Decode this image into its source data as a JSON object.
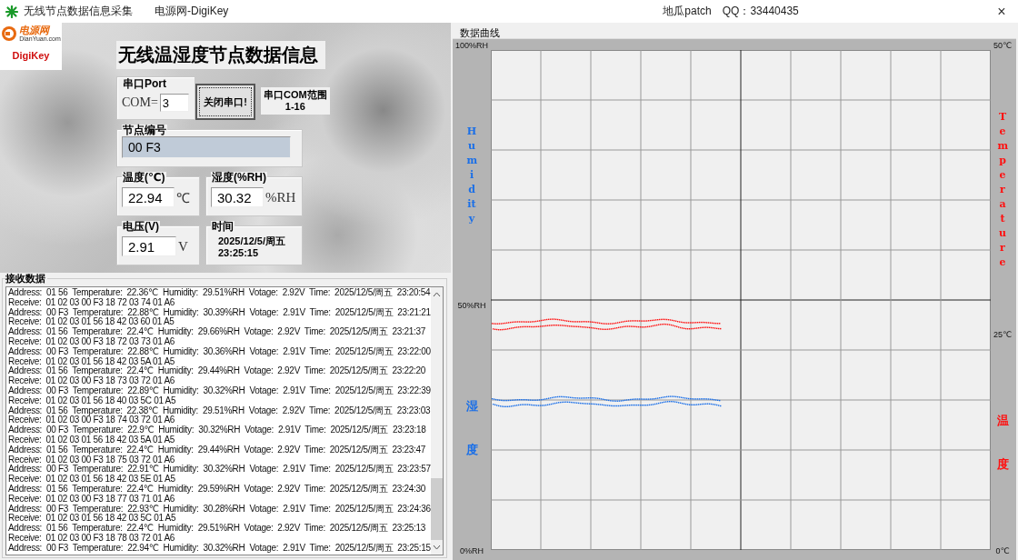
{
  "title_bar": {
    "app_title": "无线节点数据信息采集",
    "menu_item": "电源网-DigiKey",
    "author": "地瓜patch",
    "contact": "QQ：33440435",
    "close": "×"
  },
  "logos": {
    "brand_top": "电源网",
    "brand_top_sub": "DianYuan.com",
    "brand_bottom": "DigiKey"
  },
  "heading": "无线温湿度节点数据信息",
  "port": {
    "label": "串口Port",
    "prefix": "COM=",
    "value": "3",
    "button": "关闭串口!",
    "range_lines": [
      "串口COM范围",
      "1-16"
    ]
  },
  "node": {
    "label": "节点编号",
    "value": "00 F3"
  },
  "readings": [
    {
      "label": "温度(℃)",
      "value": "22.94",
      "unit": "℃"
    },
    {
      "label": "湿度(%RH)",
      "value": "30.32",
      "unit": "%RH"
    },
    {
      "label": "电压(V)",
      "value": "2.91",
      "unit": "V"
    }
  ],
  "time": {
    "label": "时间",
    "lines": [
      "2025/12/5/周五",
      "23:25:15"
    ]
  },
  "log": {
    "title": "接收数据",
    "lines": [
      "Address:  01 56  Temperature:  22.36℃  Humidity:  29.51%RH  Votage:  2.92V  Time:  2025/12/5/周五  23:20:54",
      "Receive:  01 02 03 00 F3 18 72 03 74 01 A6",
      "Address:  00 F3  Temperature:  22.88℃  Humidity:  30.39%RH  Votage:  2.91V  Time:  2025/12/5/周五  23:21:21",
      "Receive:  01 02 03 01 56 18 42 03 60 01 A5",
      "Address:  01 56  Temperature:  22.4℃  Humidity:  29.66%RH  Votage:  2.92V  Time:  2025/12/5/周五  23:21:37",
      "Receive:  01 02 03 00 F3 18 72 03 73 01 A6",
      "Address:  00 F3  Temperature:  22.88℃  Humidity:  30.36%RH  Votage:  2.91V  Time:  2025/12/5/周五  23:22:00",
      "Receive:  01 02 03 01 56 18 42 03 5A 01 A5",
      "Address:  01 56  Temperature:  22.4℃  Humidity:  29.44%RH  Votage:  2.92V  Time:  2025/12/5/周五  23:22:20",
      "Receive:  01 02 03 00 F3 18 73 03 72 01 A6",
      "Address:  00 F3  Temperature:  22.89℃  Humidity:  30.32%RH  Votage:  2.91V  Time:  2025/12/5/周五  23:22:39",
      "Receive:  01 02 03 01 56 18 40 03 5C 01 A5",
      "Address:  01 56  Temperature:  22.38℃  Humidity:  29.51%RH  Votage:  2.92V  Time:  2025/12/5/周五  23:23:03",
      "Receive:  01 02 03 00 F3 18 74 03 72 01 A6",
      "Address:  00 F3  Temperature:  22.9℃  Humidity:  30.32%RH  Votage:  2.91V  Time:  2025/12/5/周五  23:23:18",
      "Receive:  01 02 03 01 56 18 42 03 5A 01 A5",
      "Address:  01 56  Temperature:  22.4℃  Humidity:  29.44%RH  Votage:  2.92V  Time:  2025/12/5/周五  23:23:47",
      "Receive:  01 02 03 00 F3 18 75 03 72 01 A6",
      "Address:  00 F3  Temperature:  22.91℃  Humidity:  30.32%RH  Votage:  2.91V  Time:  2025/12/5/周五  23:23:57",
      "Receive:  01 02 03 01 56 18 42 03 5E 01 A5",
      "Address:  01 56  Temperature:  22.4℃  Humidity:  29.59%RH  Votage:  2.92V  Time:  2025/12/5/周五  23:24:30",
      "Receive:  01 02 03 00 F3 18 77 03 71 01 A6",
      "Address:  00 F3  Temperature:  22.93℃  Humidity:  30.28%RH  Votage:  2.91V  Time:  2025/12/5/周五  23:24:36",
      "Receive:  01 02 03 01 56 18 42 03 5C 01 A5",
      "Address:  01 56  Temperature:  22.4℃  Humidity:  29.51%RH  Votage:  2.92V  Time:  2025/12/5/周五  23:25:13",
      "Receive:  01 02 03 00 F3 18 78 03 72 01 A6",
      "Address:  00 F3  Temperature:  22.94℃  Humidity:  30.32%RH  Votage:  2.91V  Time:  2025/12/5/周五  23:25:15"
    ]
  },
  "chart": {
    "title": "数据曲线",
    "axes": [
      {
        "ticks": [
          "100%RH",
          "50%RH",
          "0%RH"
        ],
        "title": "Humidity",
        "title_cn": "湿度",
        "color": "#1a6fe8"
      },
      {
        "ticks": [
          "50℃",
          "25℃",
          "0℃"
        ],
        "title": "Temperature",
        "title_cn": "温度",
        "color": "#ff1010"
      }
    ]
  }
}
